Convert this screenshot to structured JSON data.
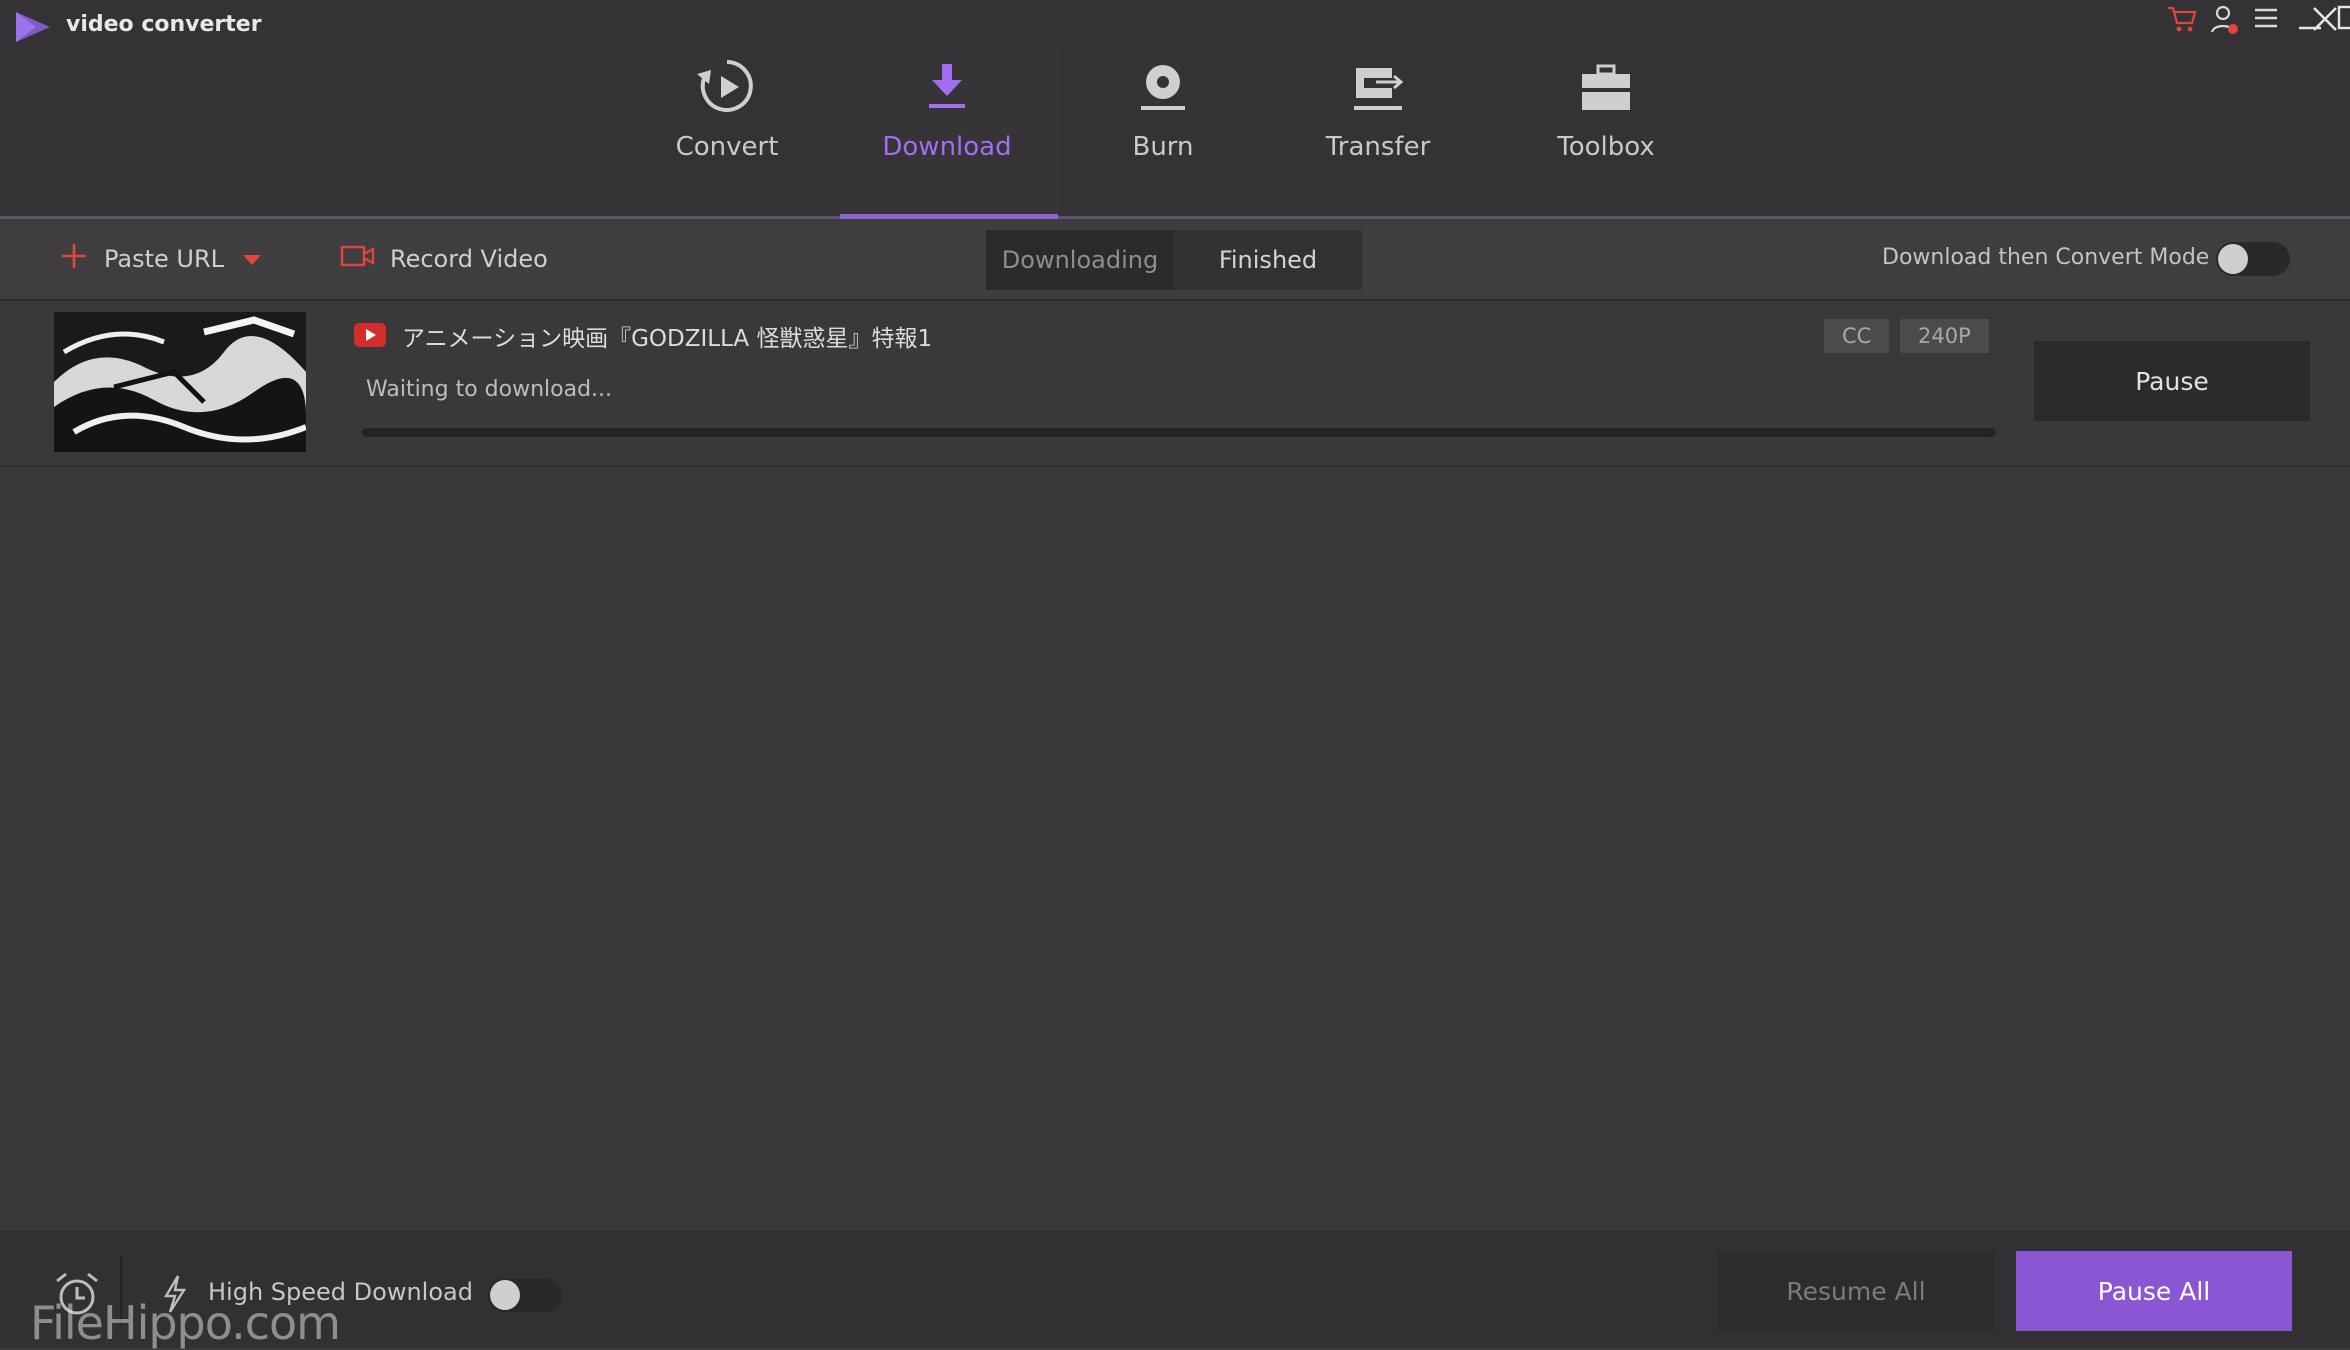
{
  "app": {
    "title": "video converter",
    "logo_icon": "play-triangle-logo"
  },
  "window_controls": [
    "cart-icon",
    "user-icon",
    "menu-icon",
    "minimize-icon",
    "maximize-icon",
    "close-icon"
  ],
  "nav": {
    "items": [
      {
        "label": "Convert",
        "icon": "convert-icon"
      },
      {
        "label": "Download",
        "icon": "download-icon"
      },
      {
        "label": "Burn",
        "icon": "burn-icon"
      },
      {
        "label": "Transfer",
        "icon": "transfer-icon"
      },
      {
        "label": "Toolbox",
        "icon": "toolbox-icon"
      }
    ],
    "active": "Download"
  },
  "toolbar": {
    "paste_url": "Paste URL",
    "record_video": "Record Video",
    "tabs": [
      "Downloading",
      "Finished"
    ],
    "active_tab": "Downloading",
    "mode_label": "Download then Convert Mode",
    "mode_enabled": false
  },
  "downloads": [
    {
      "title": "アニメーション映画『GODZILLA 怪獣惑星』特報1",
      "source_icon": "youtube-icon",
      "status": "Waiting to download...",
      "badges": [
        "CC",
        "240P"
      ],
      "progress": 0,
      "action": "Pause"
    }
  ],
  "footer": {
    "high_speed_label": "High Speed Download",
    "high_speed_enabled": false,
    "resume_all": "Resume All",
    "pause_all": "Pause All"
  },
  "watermark": "FileHippo.com",
  "colors": {
    "accent": "#8a56d4",
    "accent_text": "#a36df0",
    "background": "#3a3839",
    "header": "#343234",
    "icon_red": "#e0463e"
  }
}
